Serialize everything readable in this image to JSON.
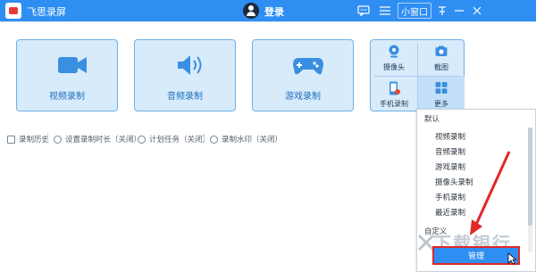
{
  "titlebar": {
    "app_name": "飞思录屏",
    "login": "登录",
    "mini_window": "小窗口",
    "icons": {
      "message": "message-icon",
      "menu": "menu-icon",
      "pin": "pin-icon",
      "minimize": "minimize-icon",
      "close": "close-icon"
    }
  },
  "cards": [
    {
      "label": "视频录制",
      "icon": "video-camera-icon"
    },
    {
      "label": "音频录制",
      "icon": "speaker-icon"
    },
    {
      "label": "游戏录制",
      "icon": "gamepad-icon"
    }
  ],
  "grid": [
    {
      "label": "摄像头",
      "icon": "webcam-icon"
    },
    {
      "label": "截图",
      "icon": "camera-icon"
    },
    {
      "label": "手机录制",
      "icon": "phone-record-icon"
    },
    {
      "label": "更多",
      "icon": "more-grid-icon"
    }
  ],
  "bottombar": [
    {
      "label": "录制历史",
      "icon": "history-icon"
    },
    {
      "label": "设置录制时长（关闭）",
      "icon": "clock-icon"
    },
    {
      "label": "计划任务（关闭）",
      "icon": "schedule-icon"
    },
    {
      "label": "录制水印（关闭）",
      "icon": "watermark-icon"
    }
  ],
  "dropdown": {
    "section_default": "默认",
    "items": [
      "视频录制",
      "音频录制",
      "游戏录制",
      "摄像头录制",
      "手机录制",
      "最近录制"
    ],
    "section_custom": "自定义",
    "manage": "管理"
  },
  "watermark_text": "下载银行",
  "colors": {
    "accent": "#2f8ef2",
    "card_bg": "#d7ebfb",
    "card_border": "#6fb0e9",
    "highlight": "#e02828"
  }
}
